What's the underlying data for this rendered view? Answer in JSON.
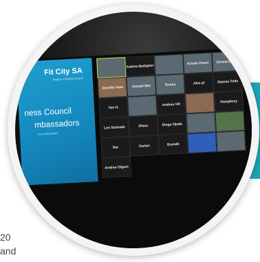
{
  "slide": {
    "logo": "Fit City SA",
    "logo_sub": "Region of Sports Council",
    "title_line_1": "ness Council",
    "title_line_2": "mbassadors",
    "subtitle": "ess Ambassador"
  },
  "participants": [
    {
      "name": "",
      "kind": "video"
    },
    {
      "name": "Andrea Battiglieri",
      "kind": "name"
    },
    {
      "name": "",
      "kind": "video"
    },
    {
      "name": "Kristin Kwon",
      "kind": "video"
    },
    {
      "name": "Donna Dean",
      "kind": "video"
    },
    {
      "name": "Jennifer Haw",
      "kind": "warm"
    },
    {
      "name": "Joseph Mar",
      "kind": "video"
    },
    {
      "name": "Teresa",
      "kind": "video"
    },
    {
      "name": "Alex pl",
      "kind": "name"
    },
    {
      "name": "Gianna Trillo",
      "kind": "name"
    },
    {
      "name": "Yan H.",
      "kind": "name"
    },
    {
      "name": "",
      "kind": "video"
    },
    {
      "name": "Andrea Vill",
      "kind": "name"
    },
    {
      "name": "",
      "kind": "warm"
    },
    {
      "name": "Humphrey",
      "kind": "name"
    },
    {
      "name": "Lee Schmale",
      "kind": "name"
    },
    {
      "name": "iPhon",
      "kind": "name"
    },
    {
      "name": "Diego Ojeda",
      "kind": "name"
    },
    {
      "name": "",
      "kind": "video"
    },
    {
      "name": "",
      "kind": "green"
    },
    {
      "name": "Rai",
      "kind": "name"
    },
    {
      "name": "Darian",
      "kind": "name"
    },
    {
      "name": "Bryndit",
      "kind": "name"
    },
    {
      "name": "",
      "kind": "blue"
    },
    {
      "name": "",
      "kind": "video"
    },
    {
      "name": "Andrea Olguin",
      "kind": "name"
    }
  ],
  "page_text": {
    "line_1": "20",
    "line_2": "and"
  }
}
